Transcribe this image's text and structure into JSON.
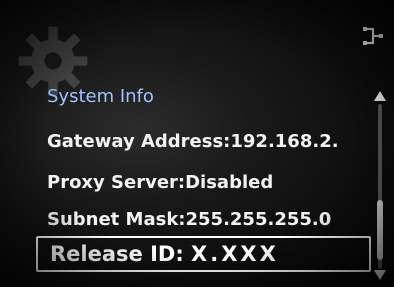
{
  "icons": {
    "background": "gear-icon",
    "top_right": "connection-icon"
  },
  "menu": {
    "title": "System Info",
    "items": [
      {
        "label": "Gateway Address:192.168.2."
      },
      {
        "label": "Proxy Server:Disabled"
      },
      {
        "label": "Subnet Mask:255.255.255.0"
      }
    ],
    "selected_item": {
      "label": "Release ID:",
      "value": "X.XXX"
    }
  },
  "scrollbar": {
    "position_fraction": 0.85
  },
  "colors": {
    "title": "#9cc4ff",
    "text": "#f2f2f2",
    "highlight_border": "#ffffff",
    "background": "#0a0a0a"
  }
}
